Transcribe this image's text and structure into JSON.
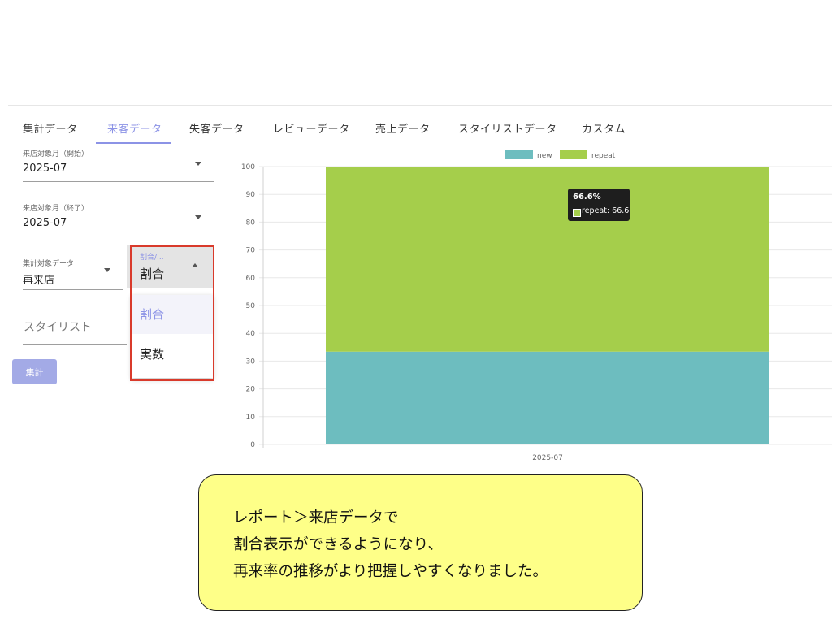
{
  "tabs": [
    {
      "label": "集計データ",
      "active": false
    },
    {
      "label": "来客データ",
      "active": true
    },
    {
      "label": "失客データ",
      "active": false
    },
    {
      "label": "レビューデータ",
      "active": false
    },
    {
      "label": "売上データ",
      "active": false
    },
    {
      "label": "スタイリストデータ",
      "active": false
    },
    {
      "label": "カスタム",
      "active": false
    }
  ],
  "filters": {
    "start_month": {
      "label": "来店対象月（開始）",
      "value": "2025-07",
      "icon": "chevron-down-icon"
    },
    "end_month": {
      "label": "来店対象月（終了）",
      "value": "2025-07",
      "icon": "chevron-down-icon"
    },
    "target_data": {
      "label": "集計対象データ",
      "value": "再来店",
      "icon": "chevron-down-icon"
    },
    "display_mode": {
      "label": "割合/...",
      "value": "割合",
      "icon": "chevron-up-icon",
      "options": [
        "割合",
        "実数"
      ],
      "selected_index": 0
    },
    "stylist": {
      "placeholder": "スタイリスト"
    }
  },
  "aggregate_button": {
    "label": "集計"
  },
  "colors": {
    "accent": "#8c93e6",
    "new": "#6dbdbf",
    "repeat": "#a5ce4b",
    "highlight": "#d93a2b",
    "callout": "#feff88"
  },
  "chart_data": {
    "type": "bar",
    "stacked": true,
    "categories": [
      "2025-07"
    ],
    "series": [
      {
        "name": "new",
        "values": [
          33.4
        ],
        "color": "#6dbdbf"
      },
      {
        "name": "repeat",
        "values": [
          66.6
        ],
        "color": "#a5ce4b"
      }
    ],
    "ylim": [
      0,
      100
    ],
    "yticks": [
      0,
      10,
      20,
      30,
      40,
      50,
      60,
      70,
      80,
      90,
      100
    ],
    "grid": true,
    "legend": "top-center",
    "tooltip": {
      "title": "66.6%",
      "body": "repeat: 66.6"
    }
  },
  "callout": {
    "lines": [
      "レポート＞来店データで",
      "割合表示ができるようになり、",
      "再来率の推移がより把握しやすくなりました。"
    ]
  }
}
